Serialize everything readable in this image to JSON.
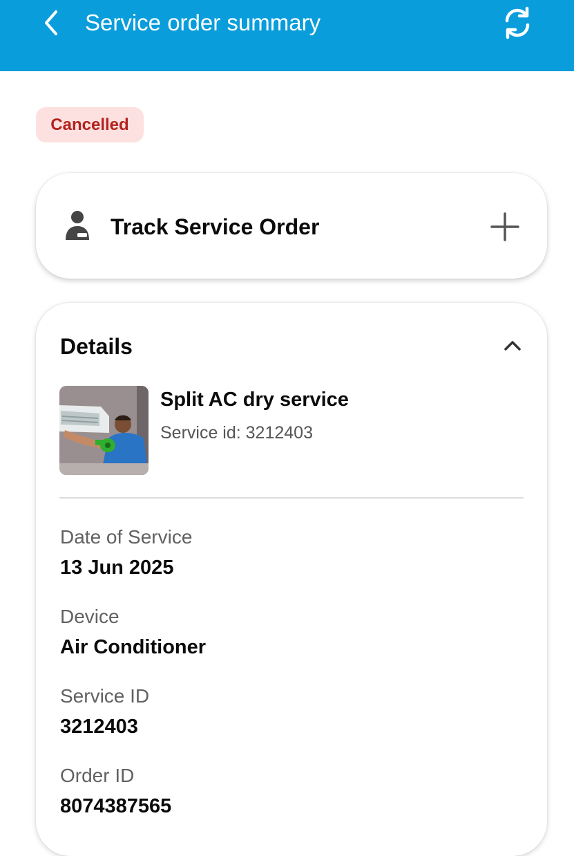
{
  "header": {
    "title": "Service order summary",
    "background_color": "#0a9ddb",
    "back_icon": "chevron-left-icon",
    "refresh_icon": "refresh-icon"
  },
  "status": {
    "label": "Cancelled",
    "text_color": "#b3221e",
    "background_color": "#fde1e0"
  },
  "track_card": {
    "label": "Track Service Order",
    "icon": "technician-icon",
    "toggle_icon": "plus-icon"
  },
  "details": {
    "heading": "Details",
    "toggle_icon": "chevron-up-icon",
    "service": {
      "name": "Split AC dry service",
      "id_line": "Service id: 3212403",
      "image": "ac-service-photo"
    },
    "fields": [
      {
        "label": "Date of Service",
        "value": "13 Jun 2025"
      },
      {
        "label": "Device",
        "value": "Air Conditioner"
      },
      {
        "label": "Service ID",
        "value": "3212403"
      },
      {
        "label": "Order ID",
        "value": "8074387565"
      }
    ]
  }
}
